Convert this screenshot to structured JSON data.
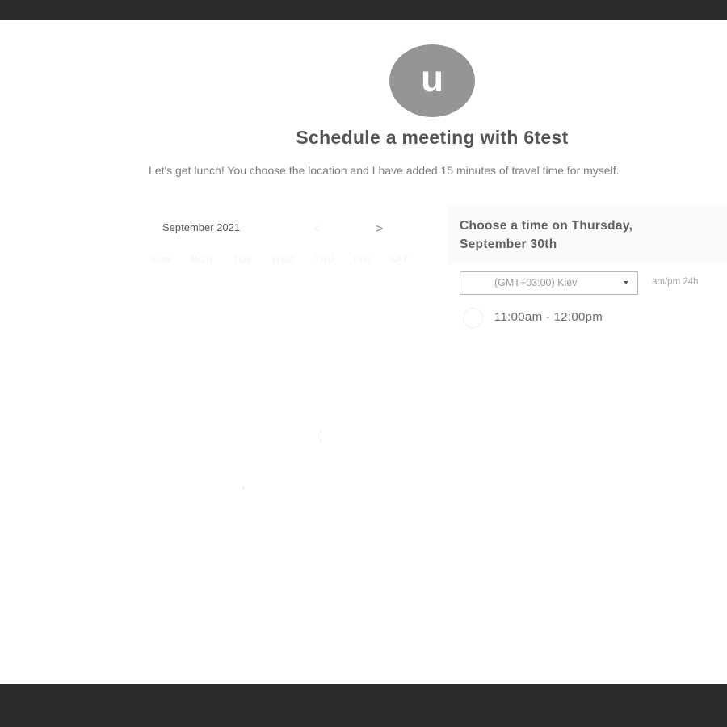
{
  "host": {
    "avatar_initial": "u",
    "title": "Schedule a meeting with 6test",
    "description": "Let's get lunch! You choose the location and I have added 15 minutes of travel time for myself."
  },
  "calendar": {
    "month_label": "September 2021",
    "prev_glyph": "<",
    "next_glyph": ">",
    "weekdays": [
      "SUN",
      "MON",
      "TUE",
      "WED",
      "THU",
      "FRI",
      "SAT"
    ]
  },
  "time_picker": {
    "heading": "Choose a time on Thursday, September 30th",
    "timezone": "(GMT+03:00) Kiev",
    "format_toggle": "am/pm  24h",
    "slots": [
      {
        "label": "11:00am - 12:00pm"
      }
    ]
  },
  "colors": {
    "avatar_bg": "#959595",
    "frame": "#2a2a2a",
    "text_dark": "#555555"
  }
}
